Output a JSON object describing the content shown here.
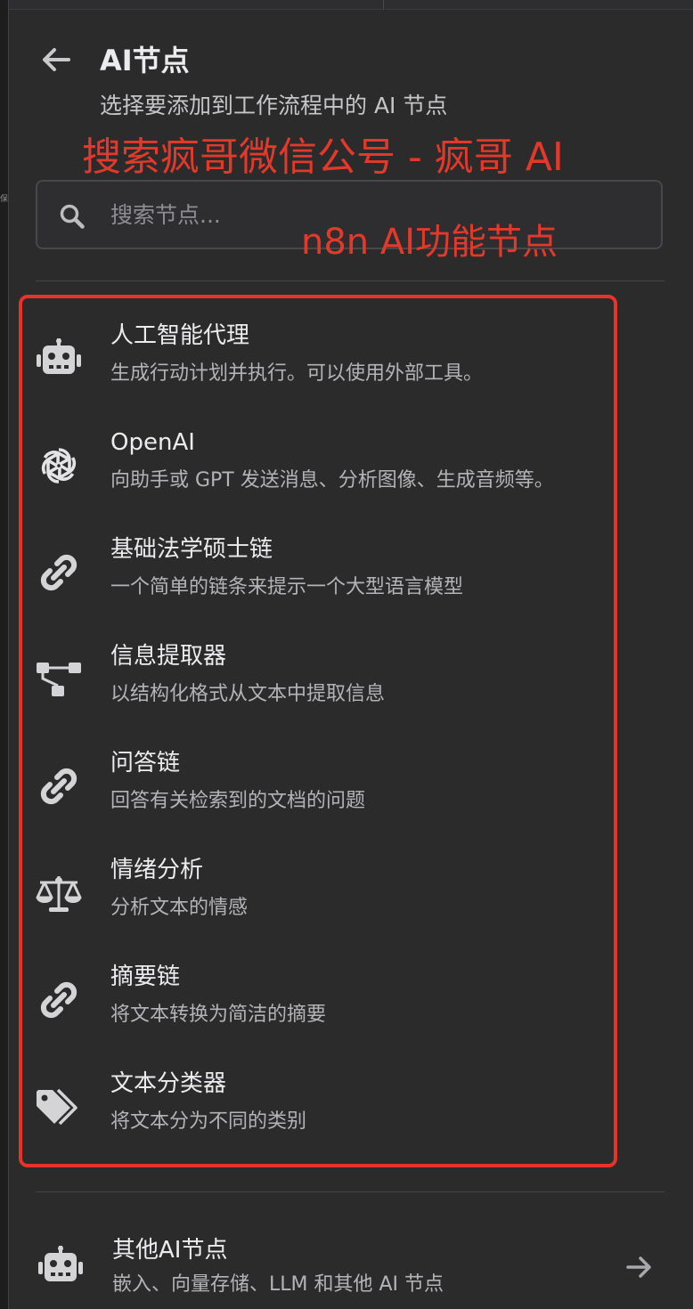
{
  "header": {
    "back_icon": "arrow-left-icon",
    "title": "AI节点",
    "subtitle": "选择要添加到工作流程中的 AI 节点"
  },
  "annotations": {
    "overlay_line1": "搜索疯哥微信公号 - 疯哥 AI",
    "overlay_line2": "n8n AI功能节点",
    "highlight_color": "#e8332b",
    "text_color": "#e3392a"
  },
  "search": {
    "icon": "search-icon",
    "placeholder": "搜索节点..."
  },
  "nodes": [
    {
      "icon": "robot-icon",
      "title": "人工智能代理",
      "description": "生成行动计划并执行。可以使用外部工具。"
    },
    {
      "icon": "openai-logo-icon",
      "title": "OpenAI",
      "description": "向助手或 GPT 发送消息、分析图像、生成音频等。"
    },
    {
      "icon": "link-icon",
      "title": "基础法学硕士链",
      "description": "一个简单的链条来提示一个大型语言模型"
    },
    {
      "icon": "sitemap-icon",
      "title": "信息提取器",
      "description": "以结构化格式从文本中提取信息"
    },
    {
      "icon": "link-icon",
      "title": "问答链",
      "description": "回答有关检索到的文档的问题"
    },
    {
      "icon": "balance-scale-icon",
      "title": "情绪分析",
      "description": "分析文本的情感"
    },
    {
      "icon": "link-icon",
      "title": "摘要链",
      "description": "将文本转换为简洁的摘要"
    },
    {
      "icon": "tags-icon",
      "title": "文本分类器",
      "description": "将文本分为不同的类别"
    }
  ],
  "other": {
    "icon": "robot-icon",
    "title": "其他AI节点",
    "description": "嵌入、向量存储、LLM 和其他 AI 节点",
    "arrow_icon": "arrow-right-icon"
  },
  "colors": {
    "background": "#2b2b2c",
    "text_primary": "#ececee",
    "text_secondary": "#b4b4b8",
    "icon": "#d4d4d7"
  }
}
